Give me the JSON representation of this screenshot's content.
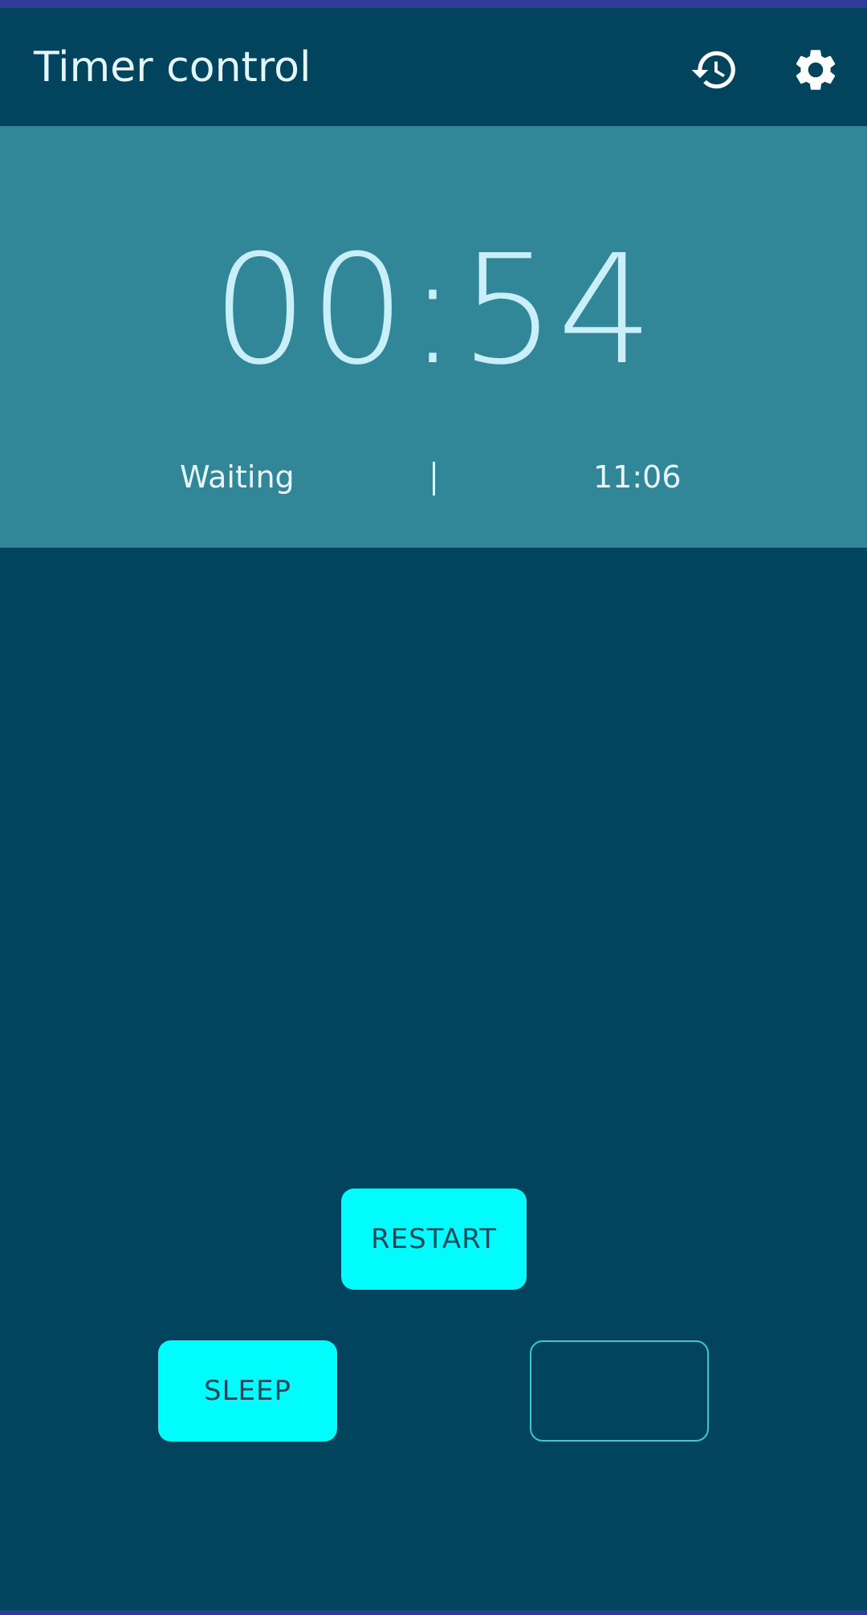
{
  "app_bar": {
    "title": "Timer control",
    "history_icon": "history-icon",
    "settings_icon": "gear-icon"
  },
  "timer": {
    "time": "00:54",
    "status": "Waiting",
    "clock": "11:06"
  },
  "buttons": {
    "restart_label": "RESTART",
    "sleep_label": "SLEEP",
    "blank_label": ""
  },
  "colors": {
    "background": "#02445e",
    "timer_panel": "#318798",
    "accent": "#00fdfd",
    "status_strip": "#2e3b9a"
  }
}
